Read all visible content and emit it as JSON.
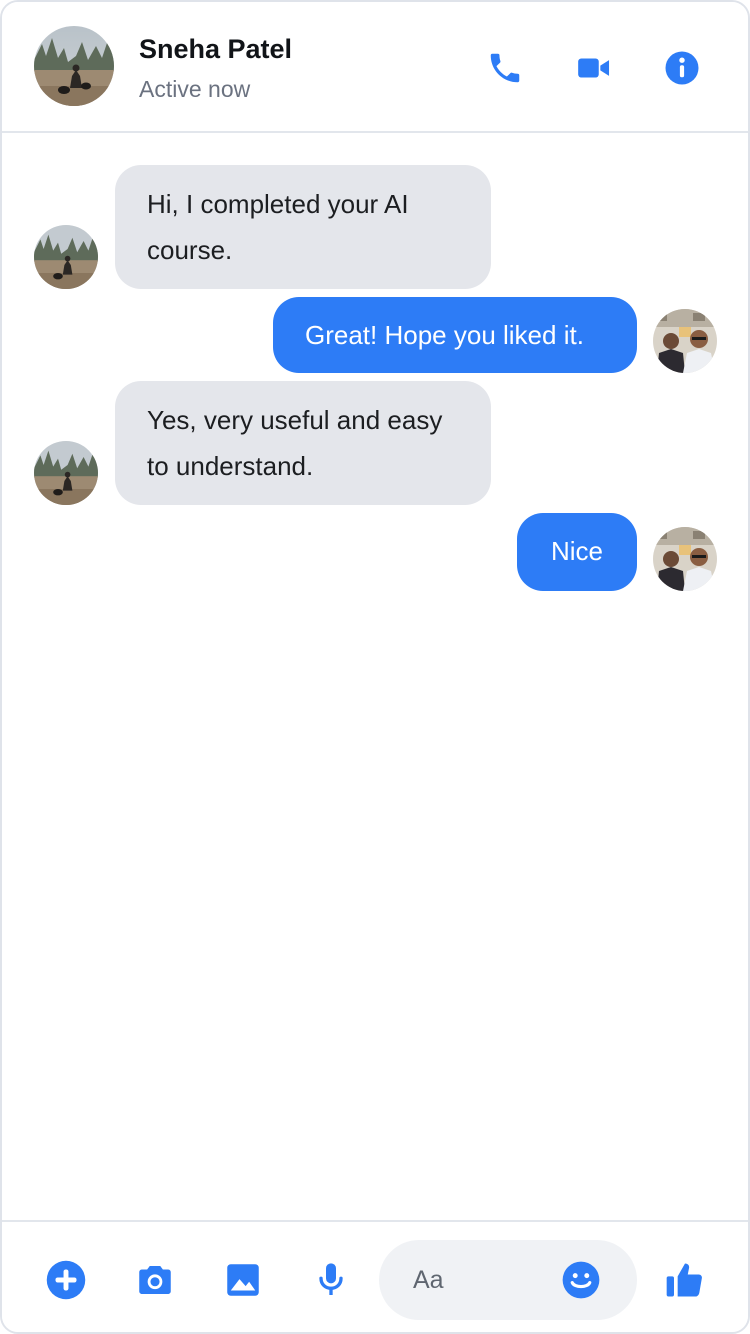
{
  "colors": {
    "accent": "#2d7cf6",
    "incoming_bubble": "#e4e6eb",
    "status_text": "#6b7280"
  },
  "header": {
    "contact_name": "Sneha Patel",
    "status": "Active now",
    "icons": [
      "phone-icon",
      "video-camera-icon",
      "info-icon"
    ]
  },
  "messages": [
    {
      "direction": "incoming",
      "text": "Hi, I completed your AI course."
    },
    {
      "direction": "outgoing",
      "text": "Great! Hope you liked it."
    },
    {
      "direction": "incoming",
      "text": "Yes, very useful and easy to understand."
    },
    {
      "direction": "outgoing",
      "text": "Nice"
    }
  ],
  "composer": {
    "placeholder": "Aa",
    "value": "",
    "icons": [
      "add-icon",
      "camera-icon",
      "image-icon",
      "microphone-icon",
      "emoji-icon",
      "thumbs-up-icon"
    ]
  }
}
